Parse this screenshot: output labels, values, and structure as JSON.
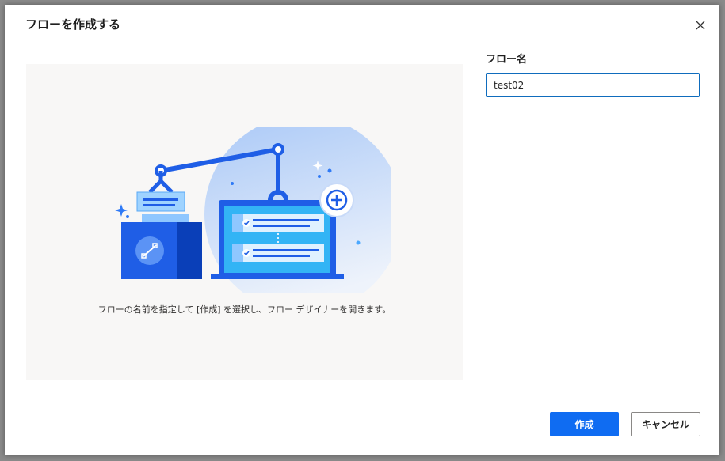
{
  "dialog": {
    "title": "フローを作成する",
    "close_icon": "close-icon"
  },
  "illustration": {
    "icon": "robot-arm-laptop-illustration",
    "caption": "フローの名前を指定して [作成] を選択し、フロー デザイナーを開きます。"
  },
  "form": {
    "flow_name_label": "フロー名",
    "flow_name_value": "test02"
  },
  "buttons": {
    "create_label": "作成",
    "cancel_label": "キャンセル"
  },
  "colors": {
    "accent": "#0f6cf2",
    "input_border": "#0f6cbd"
  }
}
